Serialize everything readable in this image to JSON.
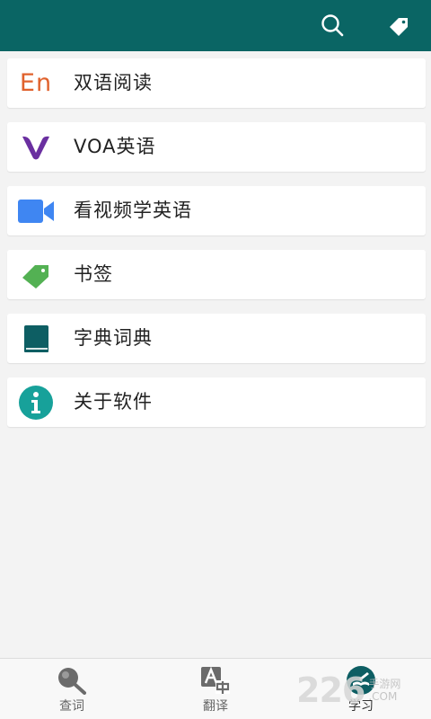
{
  "header": {
    "search_icon": "search-icon",
    "tag_icon": "tag-icon",
    "background": "#0a6564"
  },
  "menu": {
    "items": [
      {
        "label": "双语阅读",
        "icon": "en-icon",
        "icon_text": "En",
        "icon_color": "#e0622d"
      },
      {
        "label": "VOA英语",
        "icon": "voa-v-icon",
        "icon_color": "#6a2fa0"
      },
      {
        "label": "看视频学英语",
        "icon": "video-camera-icon",
        "icon_color": "#3f86f2"
      },
      {
        "label": "书签",
        "icon": "bookmark-tag-icon",
        "icon_color": "#53b153"
      },
      {
        "label": "字典词典",
        "icon": "book-icon",
        "icon_color": "#0d5e63"
      },
      {
        "label": "关于软件",
        "icon": "info-icon",
        "icon_color": "#17a19a"
      }
    ]
  },
  "bottom_nav": {
    "tabs": [
      {
        "label": "查词",
        "icon": "magnifier-icon"
      },
      {
        "label": "翻译",
        "icon": "translate-icon"
      },
      {
        "label": "学习",
        "icon": "study-icon",
        "active": true
      }
    ]
  },
  "watermark": {
    "big": "226",
    "line1": "手游网",
    "line2": ".COM"
  }
}
